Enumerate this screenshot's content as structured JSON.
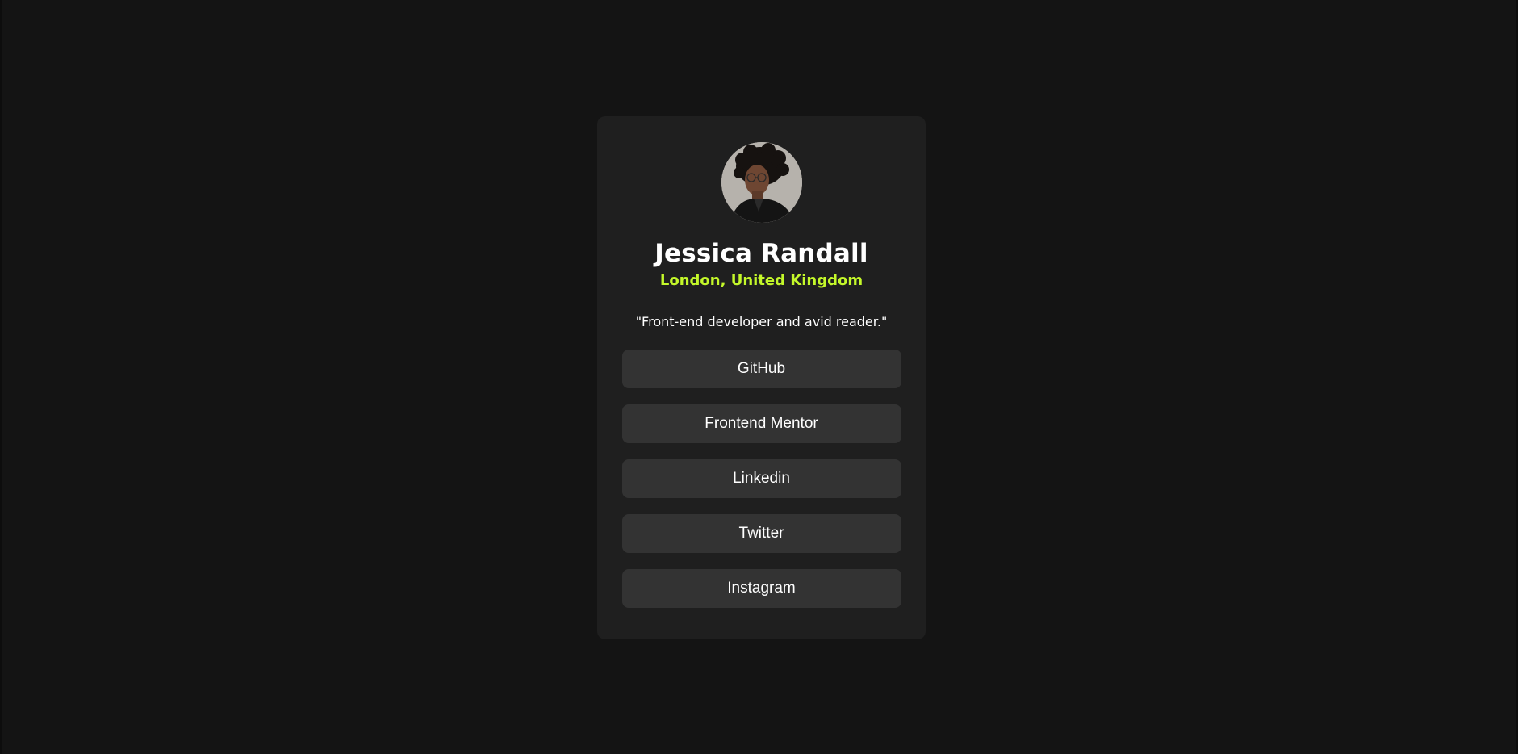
{
  "profile": {
    "name": "Jessica Randall",
    "location": "London, United Kingdom",
    "bio": "\"Front-end developer and avid reader.\"",
    "avatar_alt": "Jessica Randall"
  },
  "links": [
    {
      "label": "GitHub"
    },
    {
      "label": "Frontend Mentor"
    },
    {
      "label": "Linkedin"
    },
    {
      "label": "Twitter"
    },
    {
      "label": "Instagram"
    }
  ],
  "colors": {
    "page_background": "#141414",
    "card_background": "#1f1f1f",
    "button_background": "#333333",
    "accent": "#c4f82a",
    "text": "#ffffff"
  }
}
